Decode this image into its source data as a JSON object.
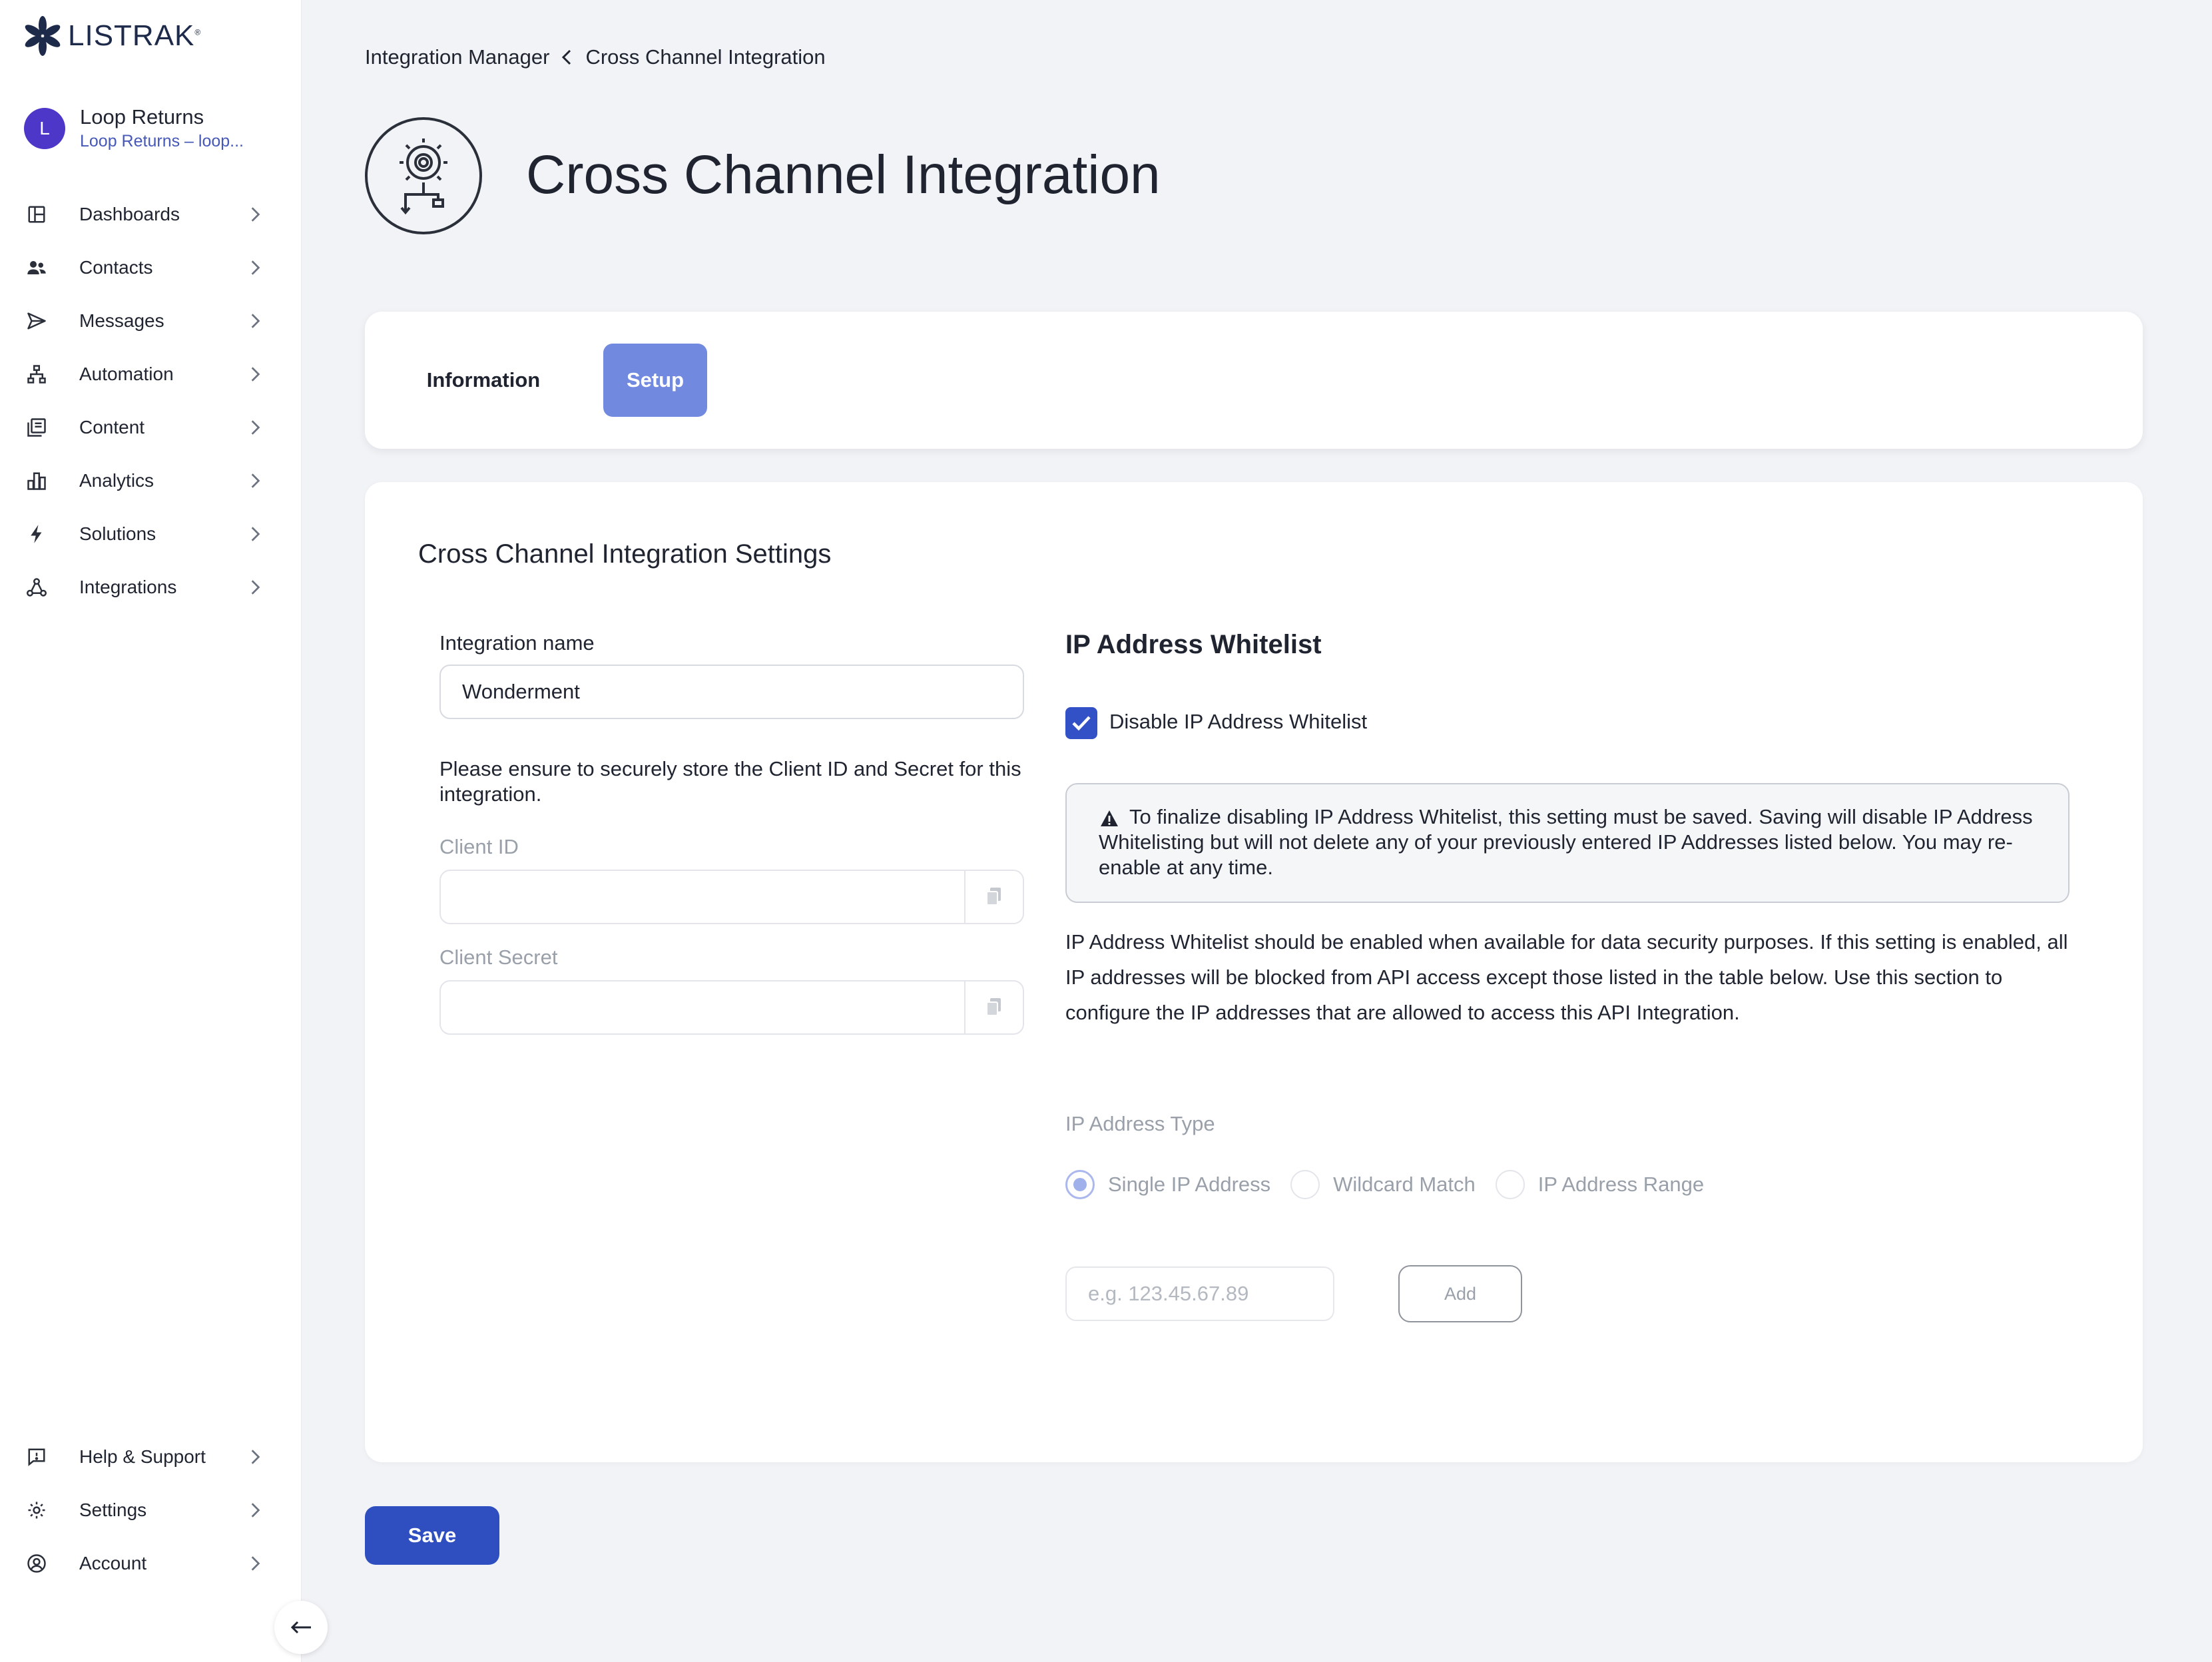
{
  "brand": {
    "name": "LISTRAK",
    "trademark": "®",
    "accent": "#2f4fc0",
    "setup_tab_color": "#7289e0",
    "avatar_color": "#4d37c8"
  },
  "account": {
    "initial": "L",
    "name": "Loop Returns",
    "subtitle": "Loop Returns – loop..."
  },
  "nav": {
    "top": [
      {
        "label": "Dashboards",
        "icon": "dashboard-icon"
      },
      {
        "label": "Contacts",
        "icon": "contacts-icon"
      },
      {
        "label": "Messages",
        "icon": "send-icon"
      },
      {
        "label": "Automation",
        "icon": "automation-icon"
      },
      {
        "label": "Content",
        "icon": "content-icon"
      },
      {
        "label": "Analytics",
        "icon": "analytics-icon"
      },
      {
        "label": "Solutions",
        "icon": "lightning-icon"
      },
      {
        "label": "Integrations",
        "icon": "integrations-icon"
      }
    ],
    "bottom": [
      {
        "label": "Help & Support",
        "icon": "help-chat-icon"
      },
      {
        "label": "Settings",
        "icon": "gear-icon"
      },
      {
        "label": "Account",
        "icon": "user-circle-icon"
      }
    ]
  },
  "breadcrumb": {
    "parent": "Integration Manager",
    "current": "Cross Channel Integration"
  },
  "page": {
    "title": "Cross Channel Integration",
    "icon": "gear-flow-icon"
  },
  "tabs": {
    "information": "Information",
    "setup": "Setup",
    "active": "Setup"
  },
  "settings": {
    "title": "Cross Channel Integration Settings",
    "integration_name_label": "Integration name",
    "integration_name_value": "Wonderment",
    "note": "Please ensure to securely store the Client ID and Secret for this integration.",
    "client_id_label": "Client ID",
    "client_id_value": "",
    "client_secret_label": "Client Secret",
    "client_secret_value": ""
  },
  "whitelist": {
    "heading": "IP Address Whitelist",
    "disable_label": "Disable IP Address Whitelist",
    "disable_checked": true,
    "alert": "To finalize disabling IP Address Whitelist, this setting must be saved. Saving will disable IP Address Whitelisting but will not delete any of your previously entered IP Addresses listed below. You may re-enable at any time.",
    "description": "IP Address Whitelist should be enabled when available for data security purposes. If this setting is enabled, all IP addresses will be blocked from API access except those listed in the table below. Use this section to configure the IP addresses that are allowed to access this API Integration.",
    "type_label": "IP Address Type",
    "types": [
      "Single IP Address",
      "Wildcard Match",
      "IP Address Range"
    ],
    "selected_type": "Single IP Address",
    "ip_placeholder": "e.g. 123.45.67.89",
    "add_label": "Add"
  },
  "save_label": "Save"
}
